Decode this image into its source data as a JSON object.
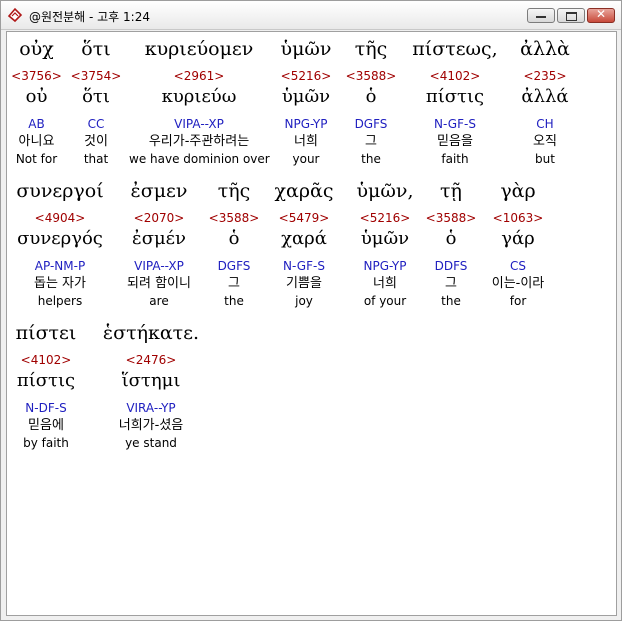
{
  "window": {
    "title": "@원전분해 - 고후 1:24"
  },
  "rows": [
    {
      "words": [
        {
          "greek": "οὐχ",
          "strong": "<3756>",
          "lemma": "οὐ",
          "parse": "AB",
          "korean": "아니요",
          "english": "Not for"
        },
        {
          "greek": "ὅτι",
          "strong": "<3754>",
          "lemma": "ὅτι",
          "parse": "CC",
          "korean": "것이",
          "english": "that"
        },
        {
          "greek": "κυριεύομεν",
          "strong": "<2961>",
          "lemma": "κυριεύω",
          "parse": "VIPA--XP",
          "korean": "우리가-주관하려는",
          "english": "we have dominion over"
        },
        {
          "greek": "ὑμῶν",
          "strong": "<5216>",
          "lemma": "ὑμῶν",
          "parse": "NPG-YP",
          "korean": "너희",
          "english": "your"
        },
        {
          "greek": "τῆς",
          "strong": "<3588>",
          "lemma": "ὁ",
          "parse": "DGFS",
          "korean": "그",
          "english": "the"
        },
        {
          "greek": "πίστεως,",
          "strong": "<4102>",
          "lemma": "πίστις",
          "parse": "N-GF-S",
          "korean": "믿음을",
          "english": "faith"
        },
        {
          "greek": "ἀλλὰ",
          "strong": "<235>",
          "lemma": "ἀλλά",
          "parse": "CH",
          "korean": "오직",
          "english": "but"
        }
      ]
    },
    {
      "words": [
        {
          "greek": "συνεργοί",
          "strong": "<4904>",
          "lemma": "συνεργός",
          "parse": "AP-NM-P",
          "korean": "돕는 자가",
          "english": "helpers"
        },
        {
          "greek": "ἐσμεν",
          "strong": "<2070>",
          "lemma": "ἐσμέν",
          "parse": "VIPA--XP",
          "korean": "되려 함이니",
          "english": "are"
        },
        {
          "greek": "τῆς",
          "strong": "<3588>",
          "lemma": "ὁ",
          "parse": "DGFS",
          "korean": "그",
          "english": "the"
        },
        {
          "greek": "χαρᾶς",
          "strong": "<5479>",
          "lemma": "χαρά",
          "parse": "N-GF-S",
          "korean": "기쁨을",
          "english": "joy"
        },
        {
          "greek": "ὑμῶν,",
          "strong": "<5216>",
          "lemma": "ὑμῶν",
          "parse": "NPG-YP",
          "korean": "너희",
          "english": "of your"
        },
        {
          "greek": "τῇ",
          "strong": "<3588>",
          "lemma": "ὁ",
          "parse": "DDFS",
          "korean": "그",
          "english": "the"
        },
        {
          "greek": "γὰρ",
          "strong": "<1063>",
          "lemma": "γάρ",
          "parse": "CS",
          "korean": "이는-이라",
          "english": "for"
        }
      ]
    },
    {
      "words": [
        {
          "greek": "πίστει",
          "strong": "<4102>",
          "lemma": "πίστις",
          "parse": "N-DF-S",
          "korean": "믿음에",
          "english": "by faith"
        },
        {
          "greek": "ἑστήκατε.",
          "strong": "<2476>",
          "lemma": "ἵστημι",
          "parse": "VIRA--YP",
          "korean": "너희가-셨음",
          "english": "ye stand"
        }
      ]
    }
  ]
}
